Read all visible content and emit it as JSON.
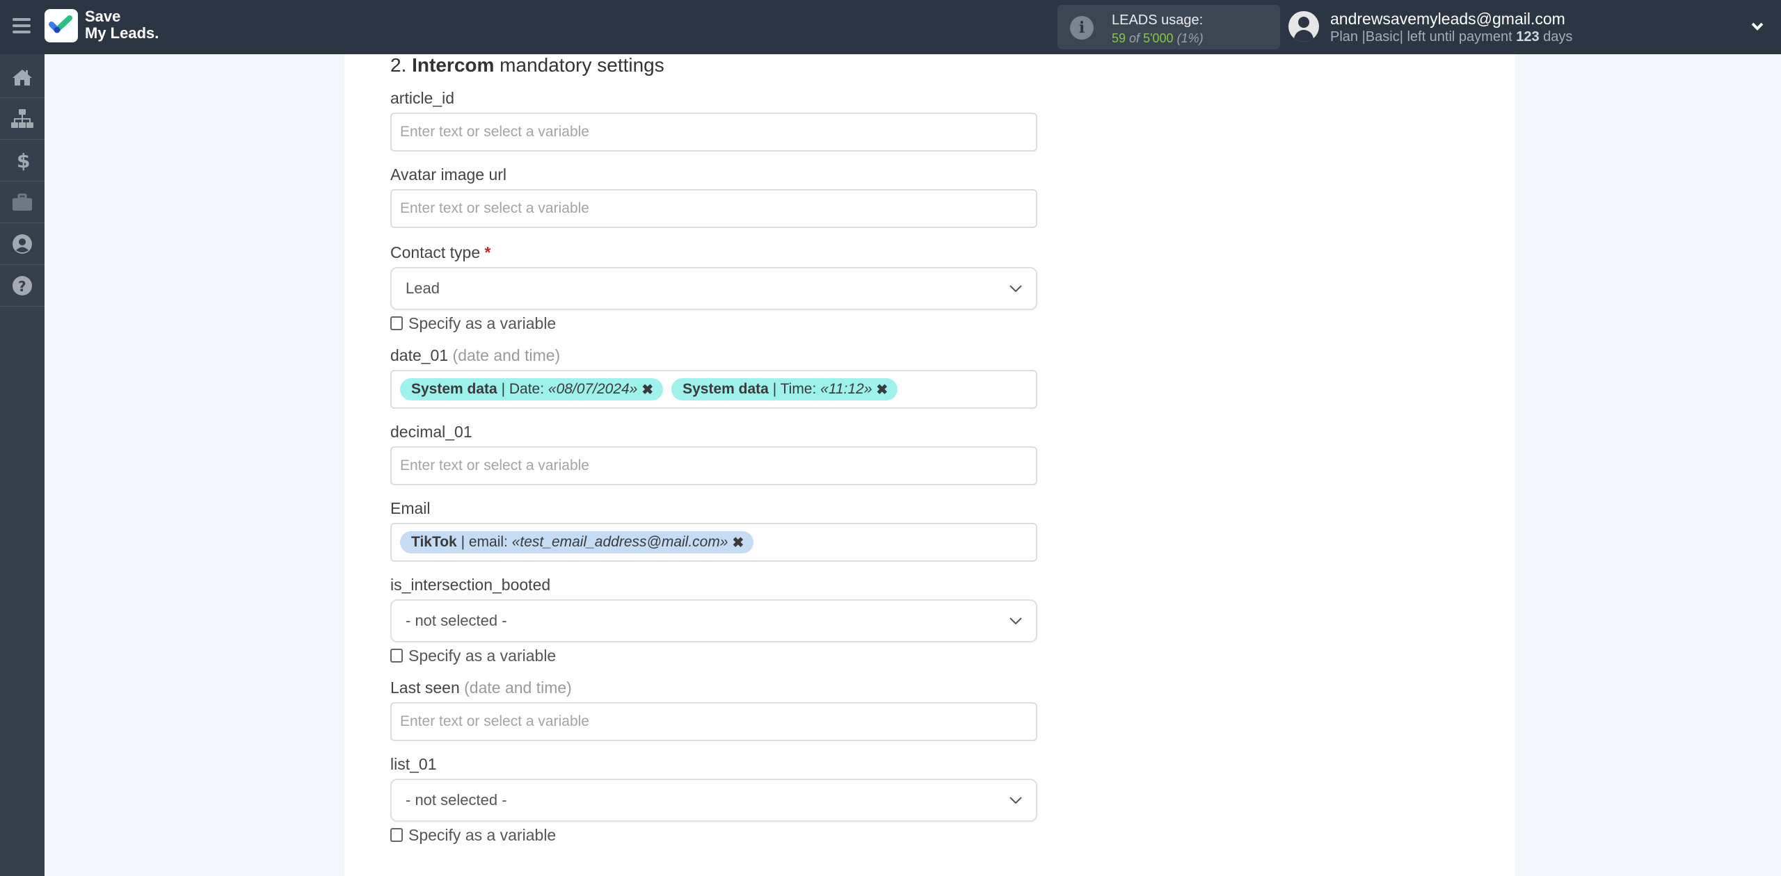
{
  "header": {
    "brand_line1": "Save",
    "brand_line2": "My Leads.",
    "usage": {
      "title": "LEADS usage:",
      "used": "59",
      "of_label": "of",
      "limit": "5'000",
      "percent": "(1%)"
    },
    "account": {
      "email": "andrewsavemyleads@gmail.com",
      "plan_prefix": "Plan |Basic| left until payment",
      "days_left": "123",
      "days_suffix": "days"
    }
  },
  "sidebar": {
    "items": [
      {
        "name": "home"
      },
      {
        "name": "connections"
      },
      {
        "name": "billing"
      },
      {
        "name": "tools"
      },
      {
        "name": "account"
      },
      {
        "name": "help"
      }
    ]
  },
  "form": {
    "section_number": "2.",
    "section_service": "Intercom",
    "section_suffix": "mandatory settings",
    "specify_variable_label": "Specify as a variable",
    "fields": {
      "article_id": {
        "label": "article_id",
        "placeholder": "Enter text or select a variable"
      },
      "avatar": {
        "label": "Avatar image url",
        "placeholder": "Enter text or select a variable"
      },
      "contact_type": {
        "label": "Contact type",
        "required_mark": "*",
        "value": "Lead"
      },
      "date_01": {
        "label": "date_01",
        "hint": "(date and time)",
        "tags": [
          {
            "source": "System data",
            "sep": " | Date: ",
            "value": "«08/07/2024»",
            "remove": "✖"
          },
          {
            "source": "System data",
            "sep": " | Time: ",
            "value": "«11:12»",
            "remove": "✖"
          }
        ]
      },
      "decimal_01": {
        "label": "decimal_01",
        "placeholder": "Enter text or select a variable"
      },
      "email": {
        "label": "Email",
        "tags": [
          {
            "source": "TikTok",
            "sep": " | email: ",
            "value": "«test_email_address@mail.com»",
            "remove": "✖"
          }
        ]
      },
      "is_intersection_booted": {
        "label": "is_intersection_booted",
        "value": "- not selected -"
      },
      "last_seen": {
        "label": "Last seen",
        "hint": "(date and time)",
        "placeholder": "Enter text or select a variable"
      },
      "list_01": {
        "label": "list_01",
        "value": "- not selected -"
      }
    }
  }
}
